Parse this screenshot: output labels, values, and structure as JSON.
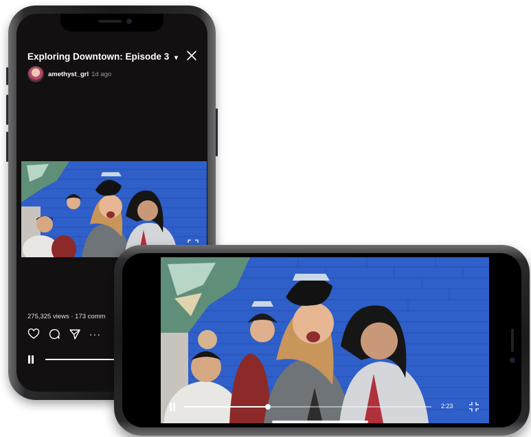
{
  "video": {
    "title": "Exploring Downtown: Episode 3",
    "caret": "▾",
    "author": "amethyst_grl",
    "posted_ago": "1d ago",
    "stats": "275,325 views · 173 comm",
    "progress": 0.52,
    "landscape_progress": 0.34,
    "duration_remaining": "2:23"
  },
  "icons": {
    "close": "close-icon",
    "expand": "expand-fullscreen-icon",
    "like": "heart-icon",
    "comment": "comment-icon",
    "share": "send-icon",
    "more": "more-icon",
    "pause": "pause-icon",
    "collapse": "exit-fullscreen-icon"
  },
  "colors": {
    "screen_bg": "#121010",
    "wall_blue": "#2f5fc9",
    "text": "#ffffff"
  }
}
